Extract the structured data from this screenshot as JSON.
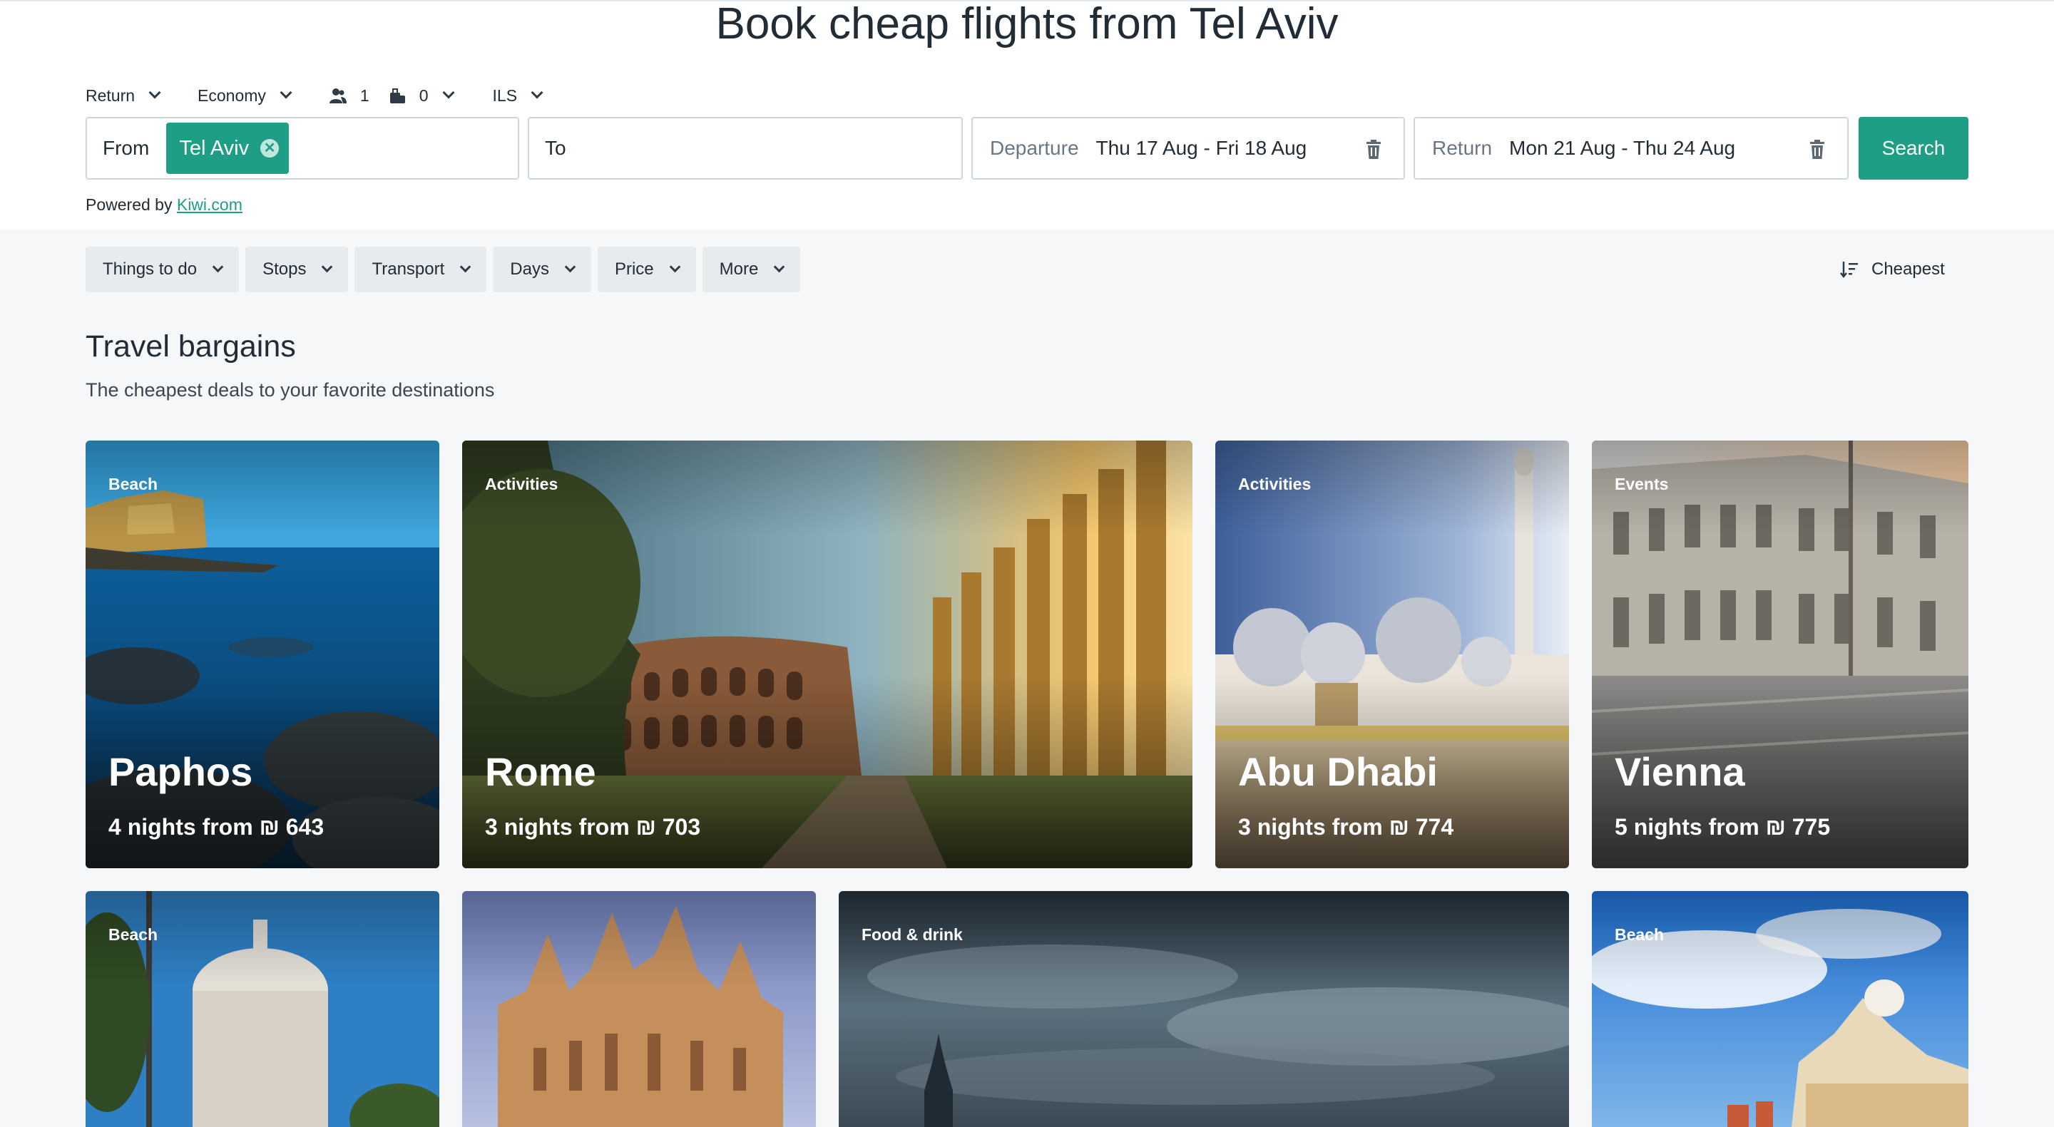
{
  "page": {
    "title": "Book cheap flights from Tel Aviv"
  },
  "options": {
    "trip_type": "Return",
    "cabin": "Economy",
    "passengers": "1",
    "bags": "0",
    "currency": "ILS"
  },
  "search": {
    "from_label": "From",
    "from_chip": "Tel Aviv",
    "to_label": "To",
    "departure_label": "Departure",
    "departure_value": "Thu 17 Aug -  Fri 18 Aug",
    "return_label": "Return",
    "return_value": "Mon 21 Aug -  Thu 24 Aug",
    "search_button": "Search",
    "powered_prefix": "Powered by",
    "powered_link": "Kiwi.com"
  },
  "filters": [
    "Things to do",
    "Stops",
    "Transport",
    "Days",
    "Price",
    "More"
  ],
  "sort": {
    "label": "Cheapest"
  },
  "section": {
    "title": "Travel bargains",
    "subtitle": "The cheapest deals to your favorite destinations"
  },
  "cards_row1": [
    {
      "tag": "Beach",
      "city": "Paphos",
      "price": "4 nights from ₪ 643"
    },
    {
      "tag": "Activities",
      "city": "Rome",
      "price": "3 nights from ₪ 703"
    },
    {
      "tag": "Activities",
      "city": "Abu Dhabi",
      "price": "3 nights from ₪ 774"
    },
    {
      "tag": "Events",
      "city": "Vienna",
      "price": "5 nights from ₪ 775"
    }
  ],
  "cards_row2": [
    {
      "tag": "Beach"
    },
    {
      "tag": ""
    },
    {
      "tag": "Food & drink"
    },
    {
      "tag": "Beach"
    }
  ],
  "colors": {
    "accent": "#1f9e86",
    "page_bg": "#f5f7f9",
    "filter_bg": "#e8ebee"
  }
}
